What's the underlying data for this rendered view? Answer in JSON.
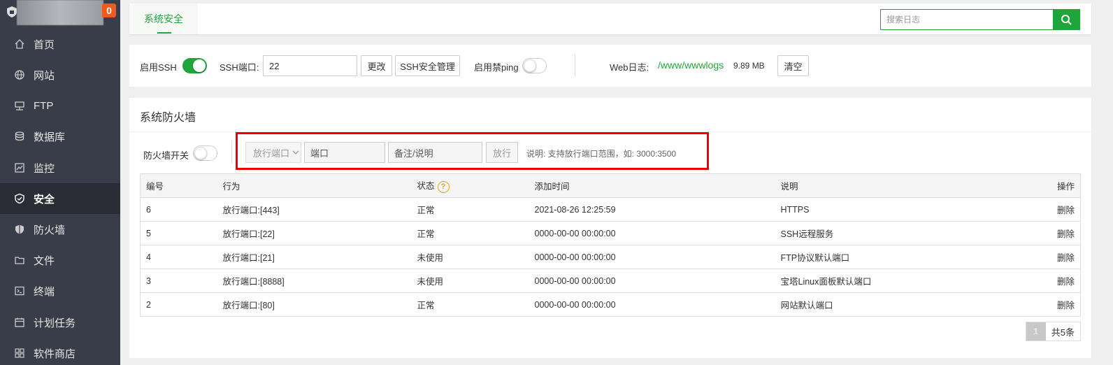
{
  "sidebar": {
    "badge": "0",
    "items": [
      {
        "label": "首页",
        "icon": "home-icon"
      },
      {
        "label": "网站",
        "icon": "globe-icon"
      },
      {
        "label": "FTP",
        "icon": "ftp-icon"
      },
      {
        "label": "数据库",
        "icon": "database-icon"
      },
      {
        "label": "监控",
        "icon": "monitor-icon"
      },
      {
        "label": "安全",
        "icon": "shield-icon",
        "active": true
      },
      {
        "label": "防火墙",
        "icon": "firewall-shield-icon"
      },
      {
        "label": "文件",
        "icon": "folder-icon"
      },
      {
        "label": "终端",
        "icon": "terminal-icon"
      },
      {
        "label": "计划任务",
        "icon": "calendar-icon"
      },
      {
        "label": "软件商店",
        "icon": "grid-icon"
      }
    ]
  },
  "tabs": {
    "active_tab": "系统安全",
    "search_placeholder": "搜索日志"
  },
  "ssh": {
    "enable_label": "启用SSH",
    "enable_on": true,
    "port_label": "SSH端口:",
    "port_value": "22",
    "change_btn": "更改",
    "manage_btn": "SSH安全管理",
    "ping_label": "启用禁ping",
    "ping_on": false,
    "weblog_label": "Web日志:",
    "weblog_path": "/www/wwwlogs",
    "weblog_size": "9.89 MB",
    "clear_btn": "清空"
  },
  "firewall": {
    "title": "系统防火墙",
    "switch_label": "防火墙开关",
    "switch_on": false,
    "select_value": "放行端口",
    "port_placeholder": "端口",
    "note_placeholder": "备注/说明",
    "allow_btn": "放行",
    "hint": "说明: 支持放行端口范围，如: 3000:3500",
    "columns": [
      "编号",
      "行为",
      "状态",
      "添加时间",
      "说明",
      "操作"
    ],
    "rows": [
      {
        "id": "6",
        "action": "放行端口:[443]",
        "status": "正常",
        "time": "2021-08-26 12:25:59",
        "note": "HTTPS",
        "op": "删除"
      },
      {
        "id": "5",
        "action": "放行端口:[22]",
        "status": "正常",
        "time": "0000-00-00 00:00:00",
        "note": "SSH远程服务",
        "op": "删除"
      },
      {
        "id": "4",
        "action": "放行端口:[21]",
        "status": "未使用",
        "time": "0000-00-00 00:00:00",
        "note": "FTP协议默认端口",
        "op": "删除"
      },
      {
        "id": "3",
        "action": "放行端口:[8888]",
        "status": "未使用",
        "time": "0000-00-00 00:00:00",
        "note": "宝塔Linux面板默认端口",
        "op": "删除"
      },
      {
        "id": "2",
        "action": "放行端口:[80]",
        "status": "正常",
        "time": "0000-00-00 00:00:00",
        "note": "网站默认端口",
        "op": "删除"
      }
    ],
    "pager_current": "1",
    "pager_total": "共5条"
  },
  "colors": {
    "accent": "#20a53a",
    "sidebar_bg": "#393d49",
    "highlight_box": "#e00000"
  }
}
